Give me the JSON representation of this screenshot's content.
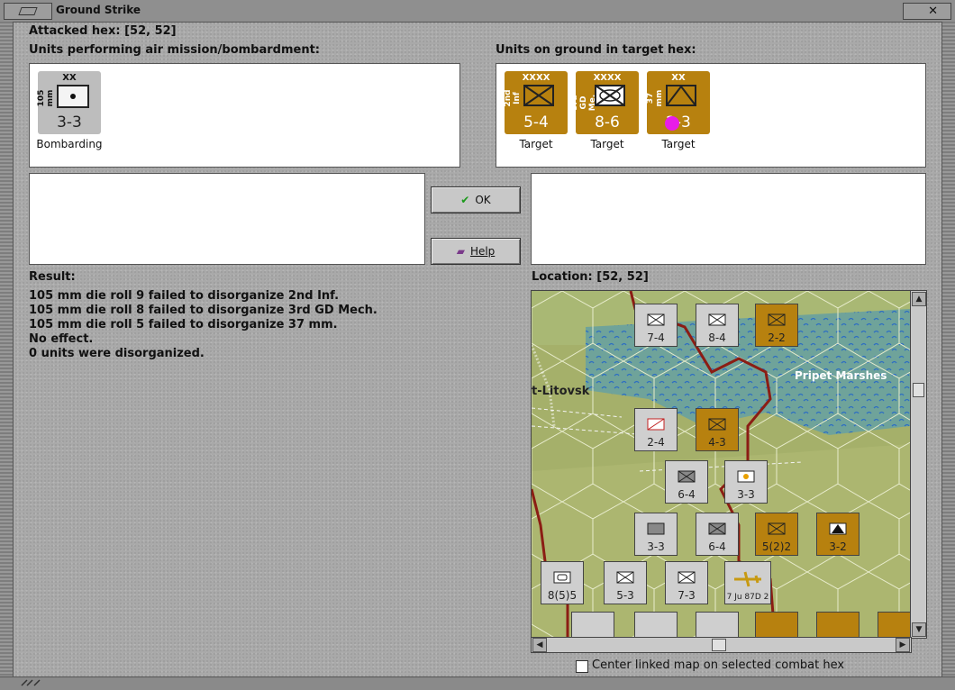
{
  "window": {
    "title": "Ground Strike",
    "close_glyph": "✕"
  },
  "attacked_hex": "Attacked hex:  [52, 52]",
  "air_units_label": "Units performing air mission/bombardment:",
  "ground_units_label": "Units on ground in target hex:",
  "air_units": [
    {
      "size": "XX",
      "side": "105 mm",
      "strength": "3-3",
      "caption": "Bombarding",
      "color": "#bdbdbd"
    }
  ],
  "ground_units": [
    {
      "size": "XXXX",
      "side": "2nd Inf",
      "strength": "5-4",
      "caption": "Target",
      "color": "#b7810f"
    },
    {
      "size": "XXXX",
      "side": "3rd GD Me.",
      "strength": "8-6",
      "caption": "Target",
      "color": "#b7810f"
    },
    {
      "size": "XX",
      "side": "37 mm",
      "strength": "2-3",
      "caption": "Target",
      "color": "#b7810f"
    }
  ],
  "buttons": {
    "ok": "OK",
    "help": "Help"
  },
  "icons": {
    "ok": "check-icon",
    "help": "book-icon"
  },
  "result_label": "Result:",
  "result_lines": [
    "105 mm die roll 9 failed to disorganize 2nd Inf.",
    "105 mm die roll 8 failed to disorganize 3rd GD Mech.",
    "105 mm die roll 5 failed to disorganize 37 mm.",
    "No effect.",
    "0 units were disorganized."
  ],
  "location_label": "Location:  [52, 52]",
  "map": {
    "place_labels": [
      "t-Litovsk",
      "Pripet Marshes"
    ],
    "counters": [
      {
        "name": "7-4",
        "color": "#cfcfcf"
      },
      {
        "name": "8-4",
        "color": "#cfcfcf"
      },
      {
        "name": "2-2",
        "color": "#b7810f"
      },
      {
        "name": "2-4",
        "color": "#cfcfcf"
      },
      {
        "name": "4-3",
        "color": "#b7810f"
      },
      {
        "name": "6-4",
        "color": "#cfcfcf"
      },
      {
        "name": "3-3",
        "color": "#cfcfcf"
      },
      {
        "name": "3-3",
        "color": "#cfcfcf"
      },
      {
        "name": "6-4",
        "color": "#cfcfcf"
      },
      {
        "name": "5(2)2",
        "color": "#b7810f"
      },
      {
        "name": "3-2",
        "color": "#b7810f"
      },
      {
        "name": "8(5)5",
        "color": "#cfcfcf"
      },
      {
        "name": "5-3",
        "color": "#cfcfcf"
      },
      {
        "name": "7-3",
        "color": "#cfcfcf"
      },
      {
        "name": "7 Ju 87D 2",
        "color": "#cfcfcf"
      }
    ]
  },
  "center_checkbox_label": "Center linked map on selected combat hex",
  "center_checkbox_checked": false
}
